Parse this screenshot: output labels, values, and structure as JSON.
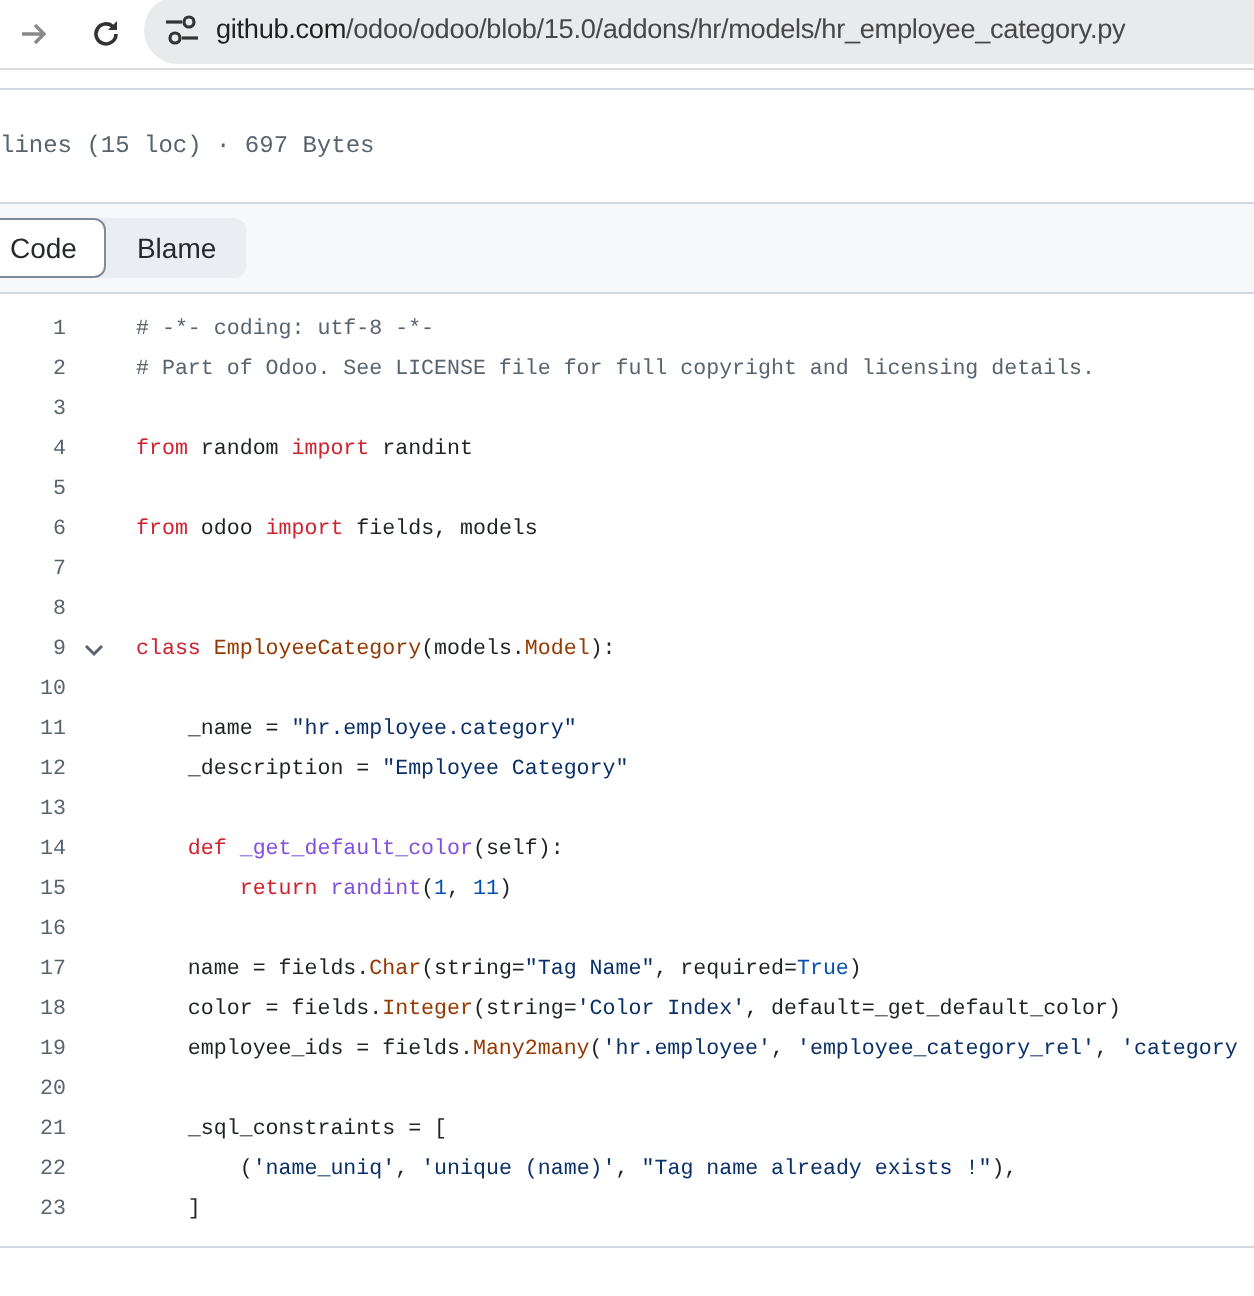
{
  "browser": {
    "url_host": "github.com",
    "url_path": "/odoo/odoo/blob/15.0/addons/hr/models/hr_employee_category.py"
  },
  "file_info": "lines (15 loc) · 697 Bytes",
  "view_tabs": [
    {
      "label": "Code",
      "selected": true
    },
    {
      "label": "Blame",
      "selected": false
    }
  ],
  "code_lines": [
    {
      "number": "1",
      "kind": "plain",
      "tokens": [
        {
          "text": "# -*- coding: utf-8 -*-",
          "kind": "comment"
        }
      ]
    },
    {
      "number": "2",
      "kind": "plain",
      "tokens": [
        {
          "text": "# Part of Odoo. See LICENSE file for full copyright and licensing details.",
          "kind": "comment"
        }
      ]
    },
    {
      "number": "3",
      "kind": "plain"
    },
    {
      "number": "4",
      "kind": "plain",
      "tokens": [
        {
          "text": "from",
          "kind": "keyword"
        },
        {
          "text": " random ",
          "kind": "plain"
        },
        {
          "text": "import",
          "kind": "keyword"
        },
        {
          "text": " randint",
          "kind": "plain"
        }
      ]
    },
    {
      "number": "5",
      "kind": "plain"
    },
    {
      "number": "6",
      "kind": "plain",
      "tokens": [
        {
          "text": "from",
          "kind": "keyword"
        },
        {
          "text": " odoo ",
          "kind": "plain"
        },
        {
          "text": "import",
          "kind": "keyword"
        },
        {
          "text": " fields, models",
          "kind": "plain"
        }
      ]
    },
    {
      "number": "7",
      "kind": "plain"
    },
    {
      "number": "8",
      "kind": "plain"
    },
    {
      "number": "9",
      "kind": "fold",
      "expanded": true,
      "tokens": [
        {
          "text": "class",
          "kind": "keyword"
        },
        {
          "text": " EmployeeCategory",
          "kind": "class"
        },
        {
          "text": "(models.",
          "kind": "plain"
        },
        {
          "text": "Model",
          "kind": "class"
        },
        {
          "text": "):",
          "kind": "plain"
        }
      ]
    },
    {
      "number": "10",
      "kind": "plain"
    },
    {
      "number": "11",
      "kind": "plain",
      "tokens": [
        {
          "text": "    _name = ",
          "kind": "plain"
        },
        {
          "text": "\"hr.employee.category\"",
          "kind": "string"
        }
      ]
    },
    {
      "number": "12",
      "kind": "plain",
      "tokens": [
        {
          "text": "    _description = ",
          "kind": "plain"
        },
        {
          "text": "\"Employee Category\"",
          "kind": "string"
        }
      ]
    },
    {
      "number": "13",
      "kind": "plain"
    },
    {
      "number": "14",
      "kind": "plain",
      "tokens": [
        {
          "text": "    def",
          "kind": "keyword"
        },
        {
          "text": " _get_default_color",
          "kind": "function"
        },
        {
          "text": "(self):",
          "kind": "plain"
        }
      ]
    },
    {
      "number": "15",
      "kind": "plain",
      "tokens": [
        {
          "text": "        return",
          "kind": "keyword"
        },
        {
          "text": " randint",
          "kind": "function"
        },
        {
          "text": "(",
          "kind": "plain"
        },
        {
          "text": "1",
          "kind": "constant"
        },
        {
          "text": ", ",
          "kind": "plain"
        },
        {
          "text": "11",
          "kind": "constant"
        },
        {
          "text": ")",
          "kind": "plain"
        }
      ]
    },
    {
      "number": "16",
      "kind": "plain"
    },
    {
      "number": "17",
      "kind": "plain",
      "tokens": [
        {
          "text": "    name = fields.",
          "kind": "plain"
        },
        {
          "text": "Char",
          "kind": "class"
        },
        {
          "text": "(string=",
          "kind": "plain"
        },
        {
          "text": "\"Tag Name\"",
          "kind": "string"
        },
        {
          "text": ", required=",
          "kind": "plain"
        },
        {
          "text": "True",
          "kind": "constant"
        },
        {
          "text": ")",
          "kind": "plain"
        }
      ]
    },
    {
      "number": "18",
      "kind": "plain",
      "tokens": [
        {
          "text": "    color = fields.",
          "kind": "plain"
        },
        {
          "text": "Integer",
          "kind": "class"
        },
        {
          "text": "(string=",
          "kind": "plain"
        },
        {
          "text": "'Color Index'",
          "kind": "string"
        },
        {
          "text": ", default=_get_default_color)",
          "kind": "plain"
        }
      ]
    },
    {
      "number": "19",
      "kind": "plain",
      "tokens": [
        {
          "text": "    employee_ids = fields.",
          "kind": "plain"
        },
        {
          "text": "Many2many",
          "kind": "class"
        },
        {
          "text": "(",
          "kind": "plain"
        },
        {
          "text": "'hr.employee'",
          "kind": "string"
        },
        {
          "text": ", ",
          "kind": "plain"
        },
        {
          "text": "'employee_category_rel'",
          "kind": "string"
        },
        {
          "text": ", ",
          "kind": "plain"
        },
        {
          "text": "'category",
          "kind": "string"
        }
      ]
    },
    {
      "number": "20",
      "kind": "plain"
    },
    {
      "number": "21",
      "kind": "plain",
      "tokens": [
        {
          "text": "    _sql_constraints = [",
          "kind": "plain"
        }
      ]
    },
    {
      "number": "22",
      "kind": "plain",
      "tokens": [
        {
          "text": "        (",
          "kind": "plain"
        },
        {
          "text": "'name_uniq'",
          "kind": "string"
        },
        {
          "text": ", ",
          "kind": "plain"
        },
        {
          "text": "'unique (name)'",
          "kind": "string"
        },
        {
          "text": ", ",
          "kind": "plain"
        },
        {
          "text": "\"Tag name already exists !\"",
          "kind": "string"
        },
        {
          "text": "),",
          "kind": "plain"
        }
      ]
    },
    {
      "number": "23",
      "kind": "plain",
      "tokens": [
        {
          "text": "    ]",
          "kind": "plain"
        }
      ]
    }
  ]
}
